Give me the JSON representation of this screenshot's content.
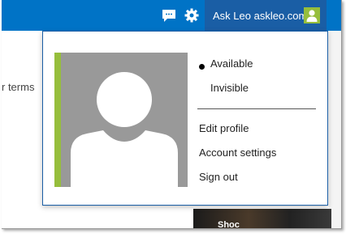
{
  "header": {
    "chat_icon": "chat-bubble-icon",
    "settings_icon": "gear-icon",
    "account_name": "Ask Leo askleo.com",
    "avatar_icon": "user-silhouette-icon",
    "bar_color": "#0073c6",
    "account_bg_color": "#1a5ea5"
  },
  "background": {
    "partial_text": "r terms",
    "image_caption": "Shoc"
  },
  "profile_menu": {
    "photo_icon": "default-profile-photo",
    "accent_color": "#96be3c",
    "status_options": [
      {
        "label": "Available",
        "selected": true
      },
      {
        "label": "Invisible",
        "selected": false
      }
    ],
    "links": [
      {
        "label": "Edit profile"
      },
      {
        "label": "Account settings"
      },
      {
        "label": "Sign out"
      }
    ]
  }
}
